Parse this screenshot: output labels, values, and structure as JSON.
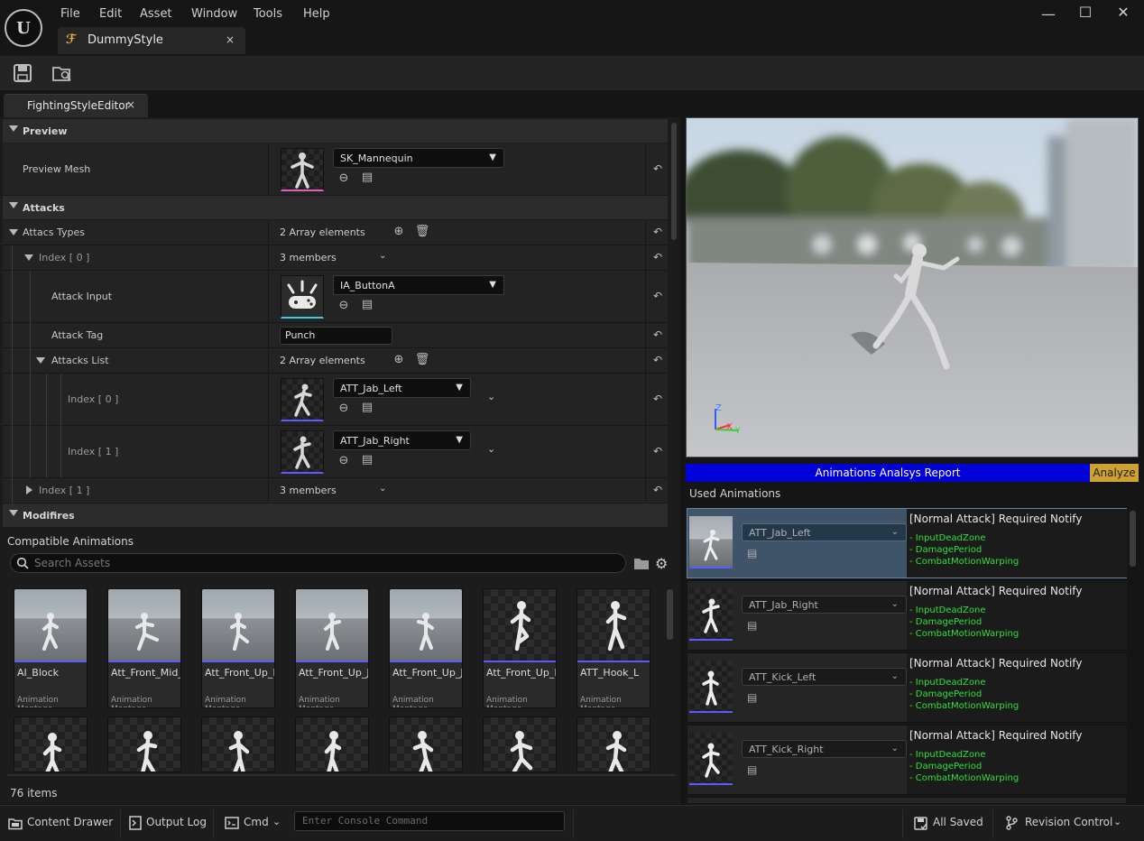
{
  "menu": [
    "File",
    "Edit",
    "Asset",
    "Window",
    "Tools",
    "Help"
  ],
  "document_tab": {
    "title": "DummyStyle",
    "close": "×"
  },
  "editor_tab": {
    "title": "FightingStyleEditor",
    "close": "×"
  },
  "details": {
    "preview": {
      "category": "Preview",
      "mesh_label": "Preview Mesh",
      "mesh_value": "SK_Mannequin"
    },
    "attacks": {
      "category": "Attacks",
      "types_label": "Attacs Types",
      "types_value": "2 Array elements",
      "index0_label": "Index [ 0 ]",
      "index0_value": "3 members",
      "attack_input_label": "Attack Input",
      "attack_input_value": "IA_ButtonA",
      "attack_tag_label": "Attack Tag",
      "attack_tag_value": "Punch",
      "attacks_list_label": "Attacks List",
      "attacks_list_value": "2 Array elements",
      "list_index0_label": "Index [ 0 ]",
      "list_index0_value": "ATT_Jab_Left",
      "list_index1_label": "Index [ 1 ]",
      "list_index1_value": "ATT_Jab_Right",
      "index1_label": "Index [ 1 ]",
      "index1_value": "3 members"
    },
    "modifiers": {
      "category": "Modifires"
    }
  },
  "compatible": {
    "title": "Compatible Animations",
    "search_placeholder": "Search Assets",
    "count": "76 items",
    "cards": [
      {
        "name": "AI_Block",
        "type": "Animation Montage"
      },
      {
        "name": "Att_Front_Mid_SideKick",
        "type": "Animation Montage"
      },
      {
        "name": "Att_Front_Up_HighKick",
        "type": "Animation Montage"
      },
      {
        "name": "Att_Front_Up_JapL",
        "type": "Animation Montage"
      },
      {
        "name": "Att_Front_Up_JapR",
        "type": "Animation Montage"
      },
      {
        "name": "Att_Front_Up_Knee",
        "type": "Animation Montage"
      },
      {
        "name": "ATT_Hook_L",
        "type": "Animation Montage"
      }
    ]
  },
  "report": {
    "title": "Animations Analsys Report",
    "analyze_label": "Analyze",
    "used_title": "Used Animations",
    "rows": [
      {
        "anim": "ATT_Jab_Left",
        "header": "[Normal Attack] Required Notify",
        "notifies": [
          "- InputDeadZone",
          "- DamagePeriod",
          "- CombatMotionWarping"
        ]
      },
      {
        "anim": "ATT_Jab_Right",
        "header": "[Normal Attack] Required Notify",
        "notifies": [
          "- InputDeadZone",
          "- DamagePeriod",
          "- CombatMotionWarping"
        ]
      },
      {
        "anim": "ATT_Kick_Left",
        "header": "[Normal Attack] Required Notify",
        "notifies": [
          "- InputDeadZone",
          "- DamagePeriod",
          "- CombatMotionWarping"
        ]
      },
      {
        "anim": "ATT_Kick_Right",
        "header": "[Normal Attack] Required Notify",
        "notifies": [
          "- InputDeadZone",
          "- DamagePeriod",
          "- CombatMotionWarping"
        ]
      }
    ]
  },
  "statusbar": {
    "content_drawer": "Content Drawer",
    "output_log": "Output Log",
    "cmd": "Cmd",
    "console_placeholder": "Enter Console Command",
    "all_saved": "All Saved",
    "revision_control": "Revision Control"
  },
  "colors": {
    "report_bar": "#0000d8",
    "analyze": "#cda230",
    "notify_green": "#2fe13a",
    "selected_row": "#3f5468"
  }
}
